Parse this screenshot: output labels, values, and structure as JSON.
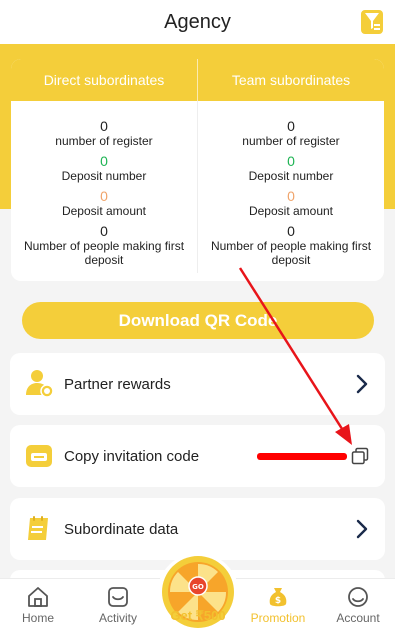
{
  "header": {
    "title": "Agency",
    "icon": "filter-icon"
  },
  "stats": {
    "direct": {
      "title": "Direct subordinates",
      "items": [
        {
          "value": "0",
          "label": "number of register"
        },
        {
          "value": "0",
          "label": "Deposit number"
        },
        {
          "value": "0",
          "label": "Deposit amount"
        },
        {
          "value": "0",
          "label": "Number of people making first deposit"
        }
      ]
    },
    "team": {
      "title": "Team subordinates",
      "items": [
        {
          "value": "0",
          "label": "number of register"
        },
        {
          "value": "0",
          "label": "Deposit number"
        },
        {
          "value": "0",
          "label": "Deposit amount"
        },
        {
          "value": "0",
          "label": "Number of people making first deposit"
        }
      ]
    }
  },
  "qr_button": {
    "label": "Download QR Code"
  },
  "menu": {
    "partner_rewards": "Partner rewards",
    "copy_invitation": "Copy invitation code",
    "subordinate_data": "Subordinate data"
  },
  "tabbar": {
    "home": "Home",
    "activity": "Activity",
    "center": "Get ₹500",
    "center_badge": "GO",
    "promotion": "Promotion",
    "account": "Account"
  },
  "colors": {
    "accent": "#f4ce3a",
    "green": "#1fb454",
    "orange": "#f0a46b"
  }
}
